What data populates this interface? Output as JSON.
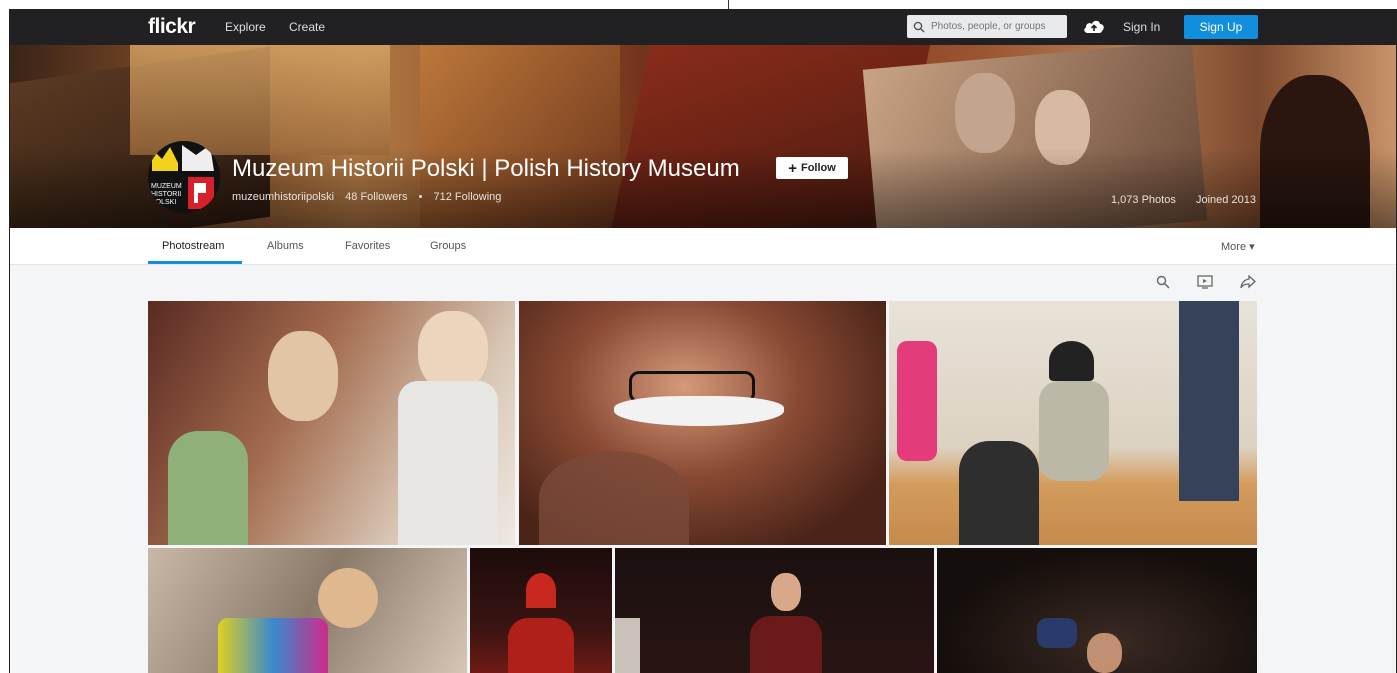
{
  "nav": {
    "logo": "flickr",
    "explore": "Explore",
    "create": "Create",
    "search_placeholder": "Photos, people, or groups",
    "sign_in": "Sign In",
    "sign_up": "Sign Up"
  },
  "profile": {
    "title": "Muzeum Historii Polski | Polish History Museum",
    "follow_label": "Follow",
    "username": "muzeumhistoriipolski",
    "followers": "48 Followers",
    "separator": "•",
    "following": "712 Following",
    "photos_count": "1,073 Photos",
    "joined": "Joined 2013",
    "avatar_text": [
      "MUZEUM",
      "HISTORII",
      "POLSKI"
    ]
  },
  "tabs": [
    {
      "label": "Photostream",
      "active": true
    },
    {
      "label": "Albums",
      "active": false
    },
    {
      "label": "Favorites",
      "active": false
    },
    {
      "label": "Groups",
      "active": false
    }
  ],
  "more_label": "More ▾",
  "tool_icons": [
    "search-icon",
    "slideshow-icon",
    "share-icon"
  ],
  "photos": [
    {
      "subject": "children-with-braids",
      "color": "#a36b4e"
    },
    {
      "subject": "girl-with-glasses-mustache",
      "color": "#6d4030"
    },
    {
      "subject": "children-playing-on-floor",
      "color": "#cfa77a"
    },
    {
      "subject": "boy-with-crafts",
      "color": "#8a7a6a"
    },
    {
      "subject": "bishop-on-stage",
      "color": "#3a1412"
    },
    {
      "subject": "actor-on-stage",
      "color": "#2a1514"
    },
    {
      "subject": "performer-in-dark",
      "color": "#1c1410"
    }
  ]
}
